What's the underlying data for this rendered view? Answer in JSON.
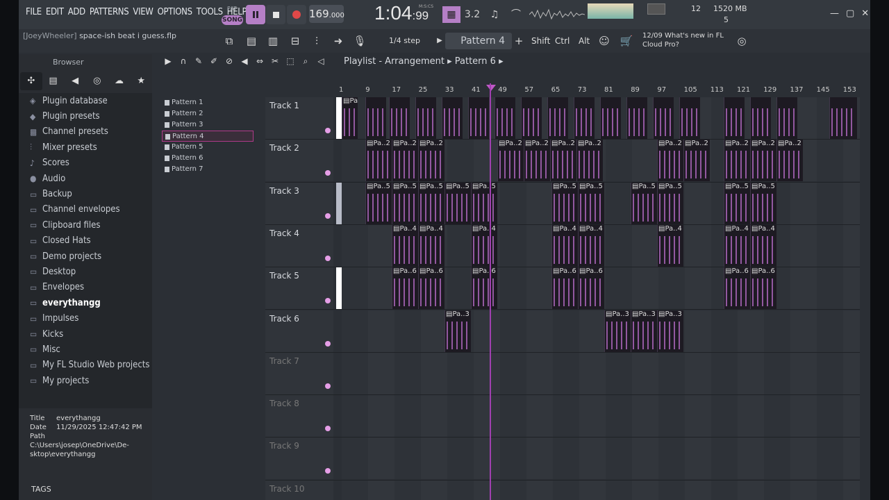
{
  "menu": [
    "FILE",
    "EDIT",
    "ADD",
    "PATTERNS",
    "VIEW",
    "OPTIONS",
    "TOOLS",
    "HELP"
  ],
  "transport": {
    "pat": "PAT",
    "song": "SONG",
    "tempo": "169",
    "tempo_dec": ".000",
    "time": "1:04",
    "time_small": ":99",
    "time_format": "M:S:CS",
    "cpu_num": "12",
    "memory": "1520 MB",
    "polyphony": "5"
  },
  "hint": {
    "user": "[JoeyWheeler]",
    "project": "space-ish beat i guess.flp"
  },
  "toolbar": {
    "snap": "1/4 step",
    "pattern": "Pattern 4",
    "shift": "Shift",
    "ctrl": "Ctrl",
    "alt": "Alt"
  },
  "news": {
    "date": "12/09",
    "text": "What's new in FL Cloud Pro?"
  },
  "browser": {
    "title": "Browser",
    "items": [
      {
        "label": "Plugin database",
        "icon": "plugin-icon"
      },
      {
        "label": "Plugin presets",
        "icon": "plugin-preset-icon"
      },
      {
        "label": "Channel presets",
        "icon": "channel-preset-icon"
      },
      {
        "label": "Mixer presets",
        "icon": "mixer-preset-icon"
      },
      {
        "label": "Scores",
        "icon": "note-icon"
      },
      {
        "label": "Audio",
        "icon": "user-icon"
      },
      {
        "label": "Backup",
        "icon": "folder-icon"
      },
      {
        "label": "Channel envelopes",
        "icon": "folder-icon"
      },
      {
        "label": "Clipboard files",
        "icon": "folder-icon"
      },
      {
        "label": "Closed Hats",
        "icon": "folder-icon"
      },
      {
        "label": "Demo projects",
        "icon": "folder-icon"
      },
      {
        "label": "Desktop",
        "icon": "folder-icon"
      },
      {
        "label": "Envelopes",
        "icon": "folder-icon"
      },
      {
        "label": "everythangg",
        "icon": "folder-icon",
        "bold": true
      },
      {
        "label": "Impulses",
        "icon": "folder-icon"
      },
      {
        "label": "Kicks",
        "icon": "folder-icon"
      },
      {
        "label": "Misc",
        "icon": "folder-icon"
      },
      {
        "label": "My FL Studio Web projects",
        "icon": "folder-icon"
      },
      {
        "label": "My projects",
        "icon": "folder-icon"
      }
    ],
    "meta": {
      "title_k": "Title",
      "title_v": "everythangg",
      "date_k": "Date",
      "date_v": "11/29/2025 12:47:42 PM",
      "path_k": "Path",
      "path_v": "C:\\Users\\josep\\OneDrive\\De-sktop\\everythangg"
    },
    "tags": "TAGS"
  },
  "patterns": [
    "Pattern 1",
    "Pattern 2",
    "Pattern 3",
    "Pattern 4",
    "Pattern 5",
    "Pattern 6",
    "Pattern 7"
  ],
  "playlist": {
    "title": "Playlist - Arrangement",
    "current": "Pattern 6",
    "ruler": [
      "1",
      "9",
      "17",
      "25",
      "33",
      "41",
      "49",
      "57",
      "65",
      "73",
      "81",
      "89",
      "97",
      "105",
      "113",
      "121",
      "129",
      "137",
      "145",
      "153"
    ],
    "tracks": [
      "Track 1",
      "Track 2",
      "Track 3",
      "Track 4",
      "Track 5",
      "Track 6",
      "Track 7",
      "Track 8",
      "Track 9",
      "Track 10"
    ]
  },
  "colors": {
    "accent": "#b57fc6",
    "playhead": "#a040b0"
  }
}
